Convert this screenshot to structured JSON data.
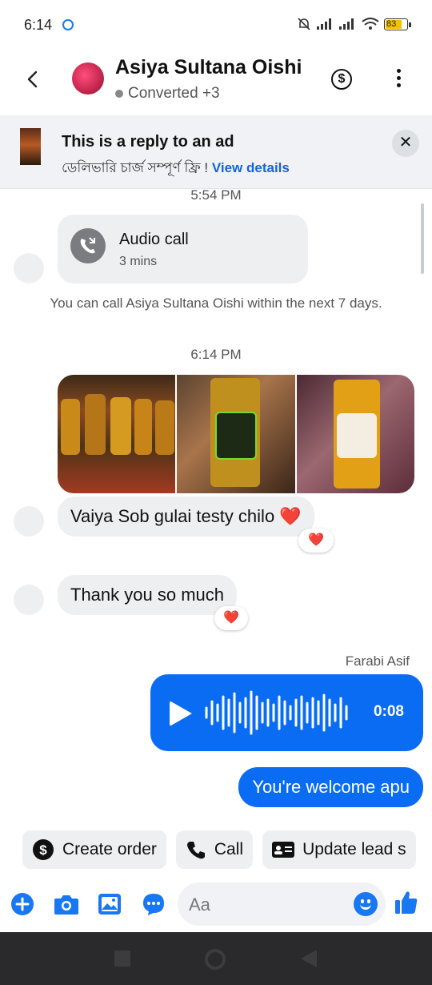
{
  "status_bar": {
    "time": "6:14",
    "battery": "83"
  },
  "header": {
    "name": "Asiya Sultana Oishi",
    "status": "Converted +3"
  },
  "ad_banner": {
    "title": "This is a reply to an ad",
    "subtitle": "ডেলিভারি চার্জ সম্পূর্ণ ফ্রি ! ",
    "link": "View details"
  },
  "messages": {
    "ts1": "5:54 PM",
    "call": {
      "title": "Audio call",
      "duration": "3 mins"
    },
    "system_notice": "You can call Asiya Sultana Oishi within the next 7 days.",
    "ts2": "6:14 PM",
    "msg1": {
      "text": "Vaiya Sob gulai testy chilo ❤️",
      "reaction": "❤️"
    },
    "msg2": {
      "text": "Thank you so much",
      "reaction": "❤️"
    },
    "sender": "Farabi Asif",
    "voice": {
      "duration": "0:08"
    },
    "reply": "You're welcome apu"
  },
  "quick_actions": [
    {
      "label": "Create order",
      "icon": "dollar-icon"
    },
    {
      "label": "Call",
      "icon": "phone-icon"
    },
    {
      "label": "Update lead s",
      "icon": "id-card-icon"
    }
  ],
  "composer": {
    "placeholder": "Aa"
  },
  "colors": {
    "accent": "#0a6cf3",
    "bubble_in": "#eeeff1",
    "heart": "#e8162b"
  }
}
